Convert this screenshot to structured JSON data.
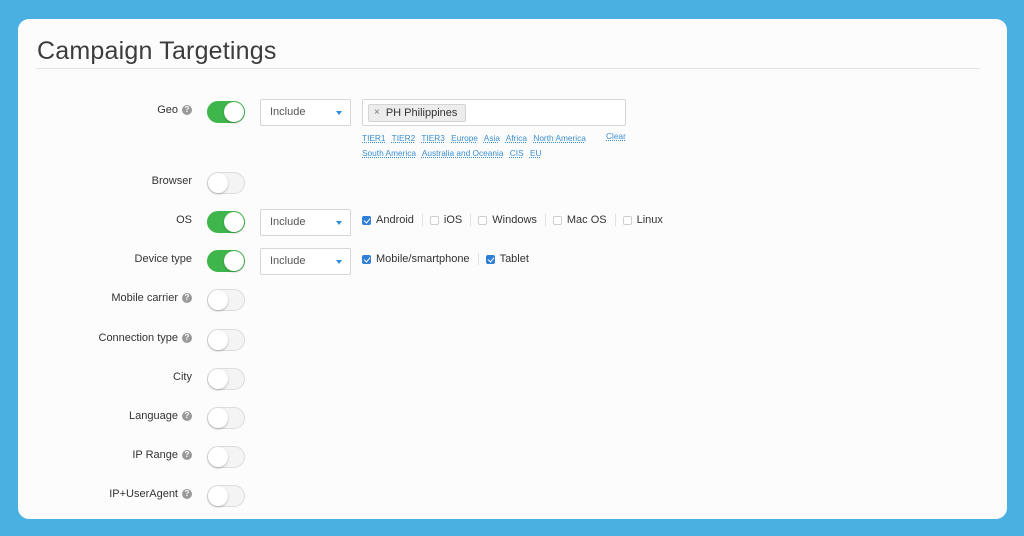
{
  "page": {
    "title": "Campaign Targetings"
  },
  "rows": [
    {
      "label": "Geo",
      "help": true,
      "enabled": true,
      "select": "Include"
    },
    {
      "label": "Browser",
      "help": false,
      "enabled": false
    },
    {
      "label": "OS",
      "help": false,
      "enabled": true,
      "select": "Include"
    },
    {
      "label": "Device type",
      "help": false,
      "enabled": true,
      "select": "Include"
    },
    {
      "label": "Mobile carrier",
      "help": true,
      "enabled": false
    },
    {
      "label": "Connection type",
      "help": true,
      "enabled": false
    },
    {
      "label": "City",
      "help": false,
      "enabled": false
    },
    {
      "label": "Language",
      "help": true,
      "enabled": false
    },
    {
      "label": "IP Range",
      "help": true,
      "enabled": false
    },
    {
      "label": "IP+UserAgent",
      "help": true,
      "enabled": false
    }
  ],
  "geo": {
    "tags": [
      {
        "remove": "×",
        "label": "PH Philippines"
      }
    ],
    "quick_links": [
      "TIER1",
      "TIER2",
      "TIER3",
      "Europe",
      "Asia",
      "Africa",
      "North America",
      "South America",
      "Australia and Oceania",
      "CIS",
      "EU"
    ],
    "clear_label": "Clear"
  },
  "os": {
    "options": [
      {
        "label": "Android",
        "checked": true
      },
      {
        "label": "iOS",
        "checked": false
      },
      {
        "label": "Windows",
        "checked": false
      },
      {
        "label": "Mac OS",
        "checked": false
      },
      {
        "label": "Linux",
        "checked": false
      }
    ]
  },
  "device_type": {
    "options": [
      {
        "label": "Mobile/smartphone",
        "checked": true
      },
      {
        "label": "Tablet",
        "checked": true
      }
    ]
  },
  "help_icon_glyph": "?",
  "colors": {
    "background": "#4ab0e2",
    "toggle_on": "#3fb64b",
    "link": "#3b8fd1",
    "checkbox": "#2f7fd8"
  }
}
